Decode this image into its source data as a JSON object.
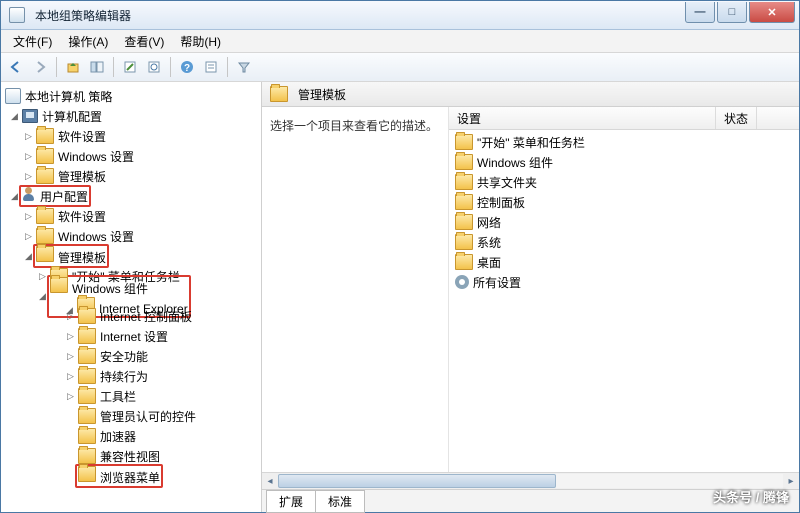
{
  "window": {
    "title": "本地组策略编辑器"
  },
  "menu": {
    "file": "文件(F)",
    "action": "操作(A)",
    "view": "查看(V)",
    "help": "帮助(H)"
  },
  "toolbar_icons": [
    "back",
    "forward",
    "up",
    "show-hide-tree",
    "export",
    "refresh",
    "help",
    "properties",
    "filter"
  ],
  "tree": {
    "root": "本地计算机 策略",
    "computer_config": "计算机配置",
    "cc_software": "软件设置",
    "cc_windows": "Windows 设置",
    "cc_admin": "管理模板",
    "user_config": "用户配置",
    "uc_software": "软件设置",
    "uc_windows": "Windows 设置",
    "uc_admin": "管理模板",
    "start_taskbar": "\"开始\" 菜单和任务栏",
    "win_components": "Windows 组件",
    "ie": "Internet Explorer",
    "ie_ctrl": "Internet 控制面板",
    "ie_settings": "Internet 设置",
    "security": "安全功能",
    "persistence": "持续行为",
    "toolbars": "工具栏",
    "admin_approved": "管理员认可的控件",
    "accelerators": "加速器",
    "compat_view": "兼容性视图",
    "browser_menu": "浏览器菜单"
  },
  "right": {
    "header": "管理模板",
    "desc": "选择一个项目来查看它的描述。",
    "col_setting": "设置",
    "col_state": "状态",
    "items": {
      "start_taskbar": "\"开始\" 菜单和任务栏",
      "win_components": "Windows 组件",
      "shared": "共享文件夹",
      "control_panel": "控制面板",
      "network": "网络",
      "system": "系统",
      "desktop": "桌面",
      "all_settings": "所有设置"
    },
    "tabs": {
      "extended": "扩展",
      "standard": "标准"
    }
  },
  "watermark": "头条号 / 腾锋"
}
